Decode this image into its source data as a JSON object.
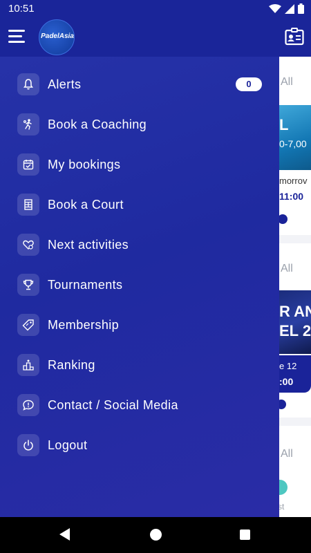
{
  "status_bar": {
    "time": "10:51"
  },
  "app_bar": {
    "logo_text": "PadelAsia"
  },
  "drawer": {
    "items": [
      {
        "label": "Alerts",
        "icon": "bell-icon",
        "badge": "0"
      },
      {
        "label": "Book a Coaching",
        "icon": "coaching-player-icon"
      },
      {
        "label": "My bookings",
        "icon": "calendar-check-icon"
      },
      {
        "label": "Book a Court",
        "icon": "court-icon"
      },
      {
        "label": "Next activities",
        "icon": "heart-icon"
      },
      {
        "label": "Tournaments",
        "icon": "trophy-icon"
      },
      {
        "label": "Membership",
        "icon": "tag-icon"
      },
      {
        "label": "Ranking",
        "icon": "podium-icon"
      },
      {
        "label": "Contact / Social Media",
        "icon": "chat-icon"
      },
      {
        "label": "Logout",
        "icon": "power-icon"
      }
    ]
  },
  "background": {
    "filter_1": "All",
    "card1_title": "L",
    "card1_price": "0-7,00",
    "card1_date": "morrov",
    "card1_time": "11:00",
    "filter_2": "All",
    "card2_title_line1": "R AN",
    "card2_title_line2": "EL 2.",
    "card2_date": "e 12",
    "card2_time": ":00",
    "filter_3": "All",
    "card3_label": "st"
  },
  "colors": {
    "brand": "#1a2399",
    "accent_teal": "#4ec7c1"
  }
}
